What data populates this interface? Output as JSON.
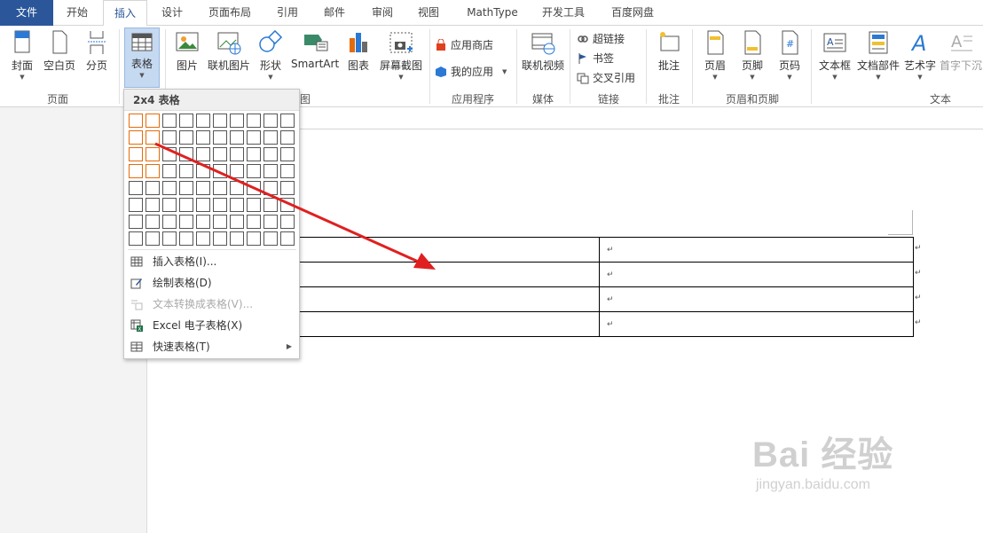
{
  "tabs": [
    "文件",
    "开始",
    "插入",
    "设计",
    "页面布局",
    "引用",
    "邮件",
    "审阅",
    "视图",
    "MathType",
    "开发工具",
    "百度网盘"
  ],
  "ribbon": {
    "cover": "封面",
    "blank_page": "空白页",
    "page_break": "分页",
    "table": "表格",
    "picture": "图片",
    "online_picture": "联机图片",
    "shapes": "形状",
    "smartart": "SmartArt",
    "chart": "图表",
    "screenshot": "屏幕截图",
    "app_store": "应用商店",
    "my_apps": "我的应用",
    "online_video": "联机视频",
    "hyperlink": "超链接",
    "bookmark": "书签",
    "cross_reference": "交叉引用",
    "comment": "批注",
    "header": "页眉",
    "footer": "页脚",
    "page_number": "页码",
    "text_box": "文本框",
    "quick_parts": "文档部件",
    "wordart": "艺术字",
    "drop_cap": "首字下沉"
  },
  "groups": {
    "pages": "页面",
    "illustrations_tail": "图",
    "apps": "应用程序",
    "media": "媒体",
    "links": "链接",
    "comments": "批注",
    "header_footer": "页眉和页脚",
    "text": "文本"
  },
  "dropdown": {
    "header": "2x4 表格",
    "grid_cols": 10,
    "grid_rows": 8,
    "selected_cols": 2,
    "selected_rows": 4,
    "items": [
      {
        "label": "插入表格(I)...",
        "disabled": false
      },
      {
        "label": "绘制表格(D)",
        "disabled": false
      },
      {
        "label": "文本转换成表格(V)...",
        "disabled": true
      },
      {
        "label": "Excel 电子表格(X)",
        "disabled": false
      },
      {
        "label": "快速表格(T)",
        "disabled": false
      }
    ]
  },
  "document": {
    "cell_mark": "↵",
    "row_end_mark": "↵",
    "rows": 4,
    "cols": 2
  },
  "watermark": {
    "main": "Bai 经验",
    "sub": "jingyan.baidu.com"
  },
  "colors": {
    "file_tab": "#2b579a",
    "grid_highlight": "#e46c0a",
    "arrow": "#e02020"
  }
}
